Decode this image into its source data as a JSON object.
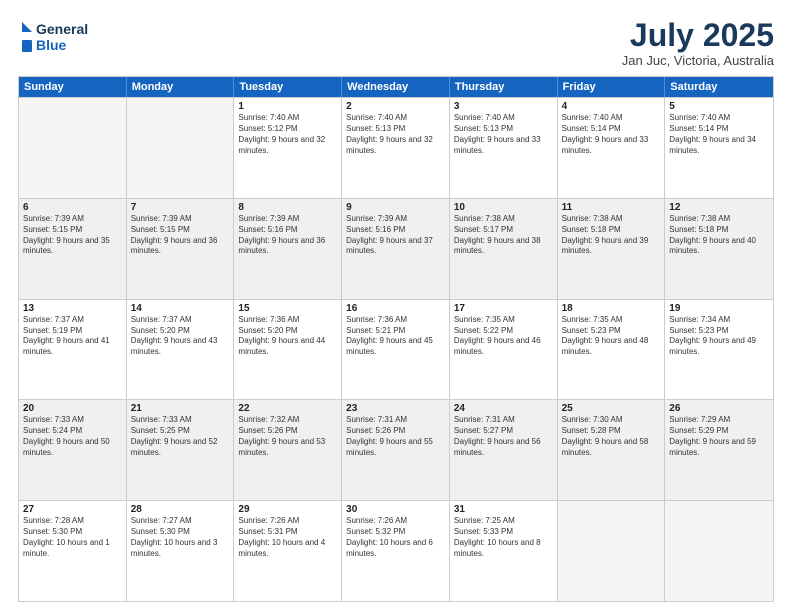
{
  "header": {
    "logo_line1": "General",
    "logo_line2": "Blue",
    "month": "July 2025",
    "location": "Jan Juc, Victoria, Australia"
  },
  "weekdays": [
    "Sunday",
    "Monday",
    "Tuesday",
    "Wednesday",
    "Thursday",
    "Friday",
    "Saturday"
  ],
  "rows": [
    [
      {
        "day": "",
        "text": ""
      },
      {
        "day": "",
        "text": ""
      },
      {
        "day": "1",
        "text": "Sunrise: 7:40 AM\nSunset: 5:12 PM\nDaylight: 9 hours and 32 minutes."
      },
      {
        "day": "2",
        "text": "Sunrise: 7:40 AM\nSunset: 5:13 PM\nDaylight: 9 hours and 32 minutes."
      },
      {
        "day": "3",
        "text": "Sunrise: 7:40 AM\nSunset: 5:13 PM\nDaylight: 9 hours and 33 minutes."
      },
      {
        "day": "4",
        "text": "Sunrise: 7:40 AM\nSunset: 5:14 PM\nDaylight: 9 hours and 33 minutes."
      },
      {
        "day": "5",
        "text": "Sunrise: 7:40 AM\nSunset: 5:14 PM\nDaylight: 9 hours and 34 minutes."
      }
    ],
    [
      {
        "day": "6",
        "text": "Sunrise: 7:39 AM\nSunset: 5:15 PM\nDaylight: 9 hours and 35 minutes."
      },
      {
        "day": "7",
        "text": "Sunrise: 7:39 AM\nSunset: 5:15 PM\nDaylight: 9 hours and 36 minutes."
      },
      {
        "day": "8",
        "text": "Sunrise: 7:39 AM\nSunset: 5:16 PM\nDaylight: 9 hours and 36 minutes."
      },
      {
        "day": "9",
        "text": "Sunrise: 7:39 AM\nSunset: 5:16 PM\nDaylight: 9 hours and 37 minutes."
      },
      {
        "day": "10",
        "text": "Sunrise: 7:38 AM\nSunset: 5:17 PM\nDaylight: 9 hours and 38 minutes."
      },
      {
        "day": "11",
        "text": "Sunrise: 7:38 AM\nSunset: 5:18 PM\nDaylight: 9 hours and 39 minutes."
      },
      {
        "day": "12",
        "text": "Sunrise: 7:38 AM\nSunset: 5:18 PM\nDaylight: 9 hours and 40 minutes."
      }
    ],
    [
      {
        "day": "13",
        "text": "Sunrise: 7:37 AM\nSunset: 5:19 PM\nDaylight: 9 hours and 41 minutes."
      },
      {
        "day": "14",
        "text": "Sunrise: 7:37 AM\nSunset: 5:20 PM\nDaylight: 9 hours and 43 minutes."
      },
      {
        "day": "15",
        "text": "Sunrise: 7:36 AM\nSunset: 5:20 PM\nDaylight: 9 hours and 44 minutes."
      },
      {
        "day": "16",
        "text": "Sunrise: 7:36 AM\nSunset: 5:21 PM\nDaylight: 9 hours and 45 minutes."
      },
      {
        "day": "17",
        "text": "Sunrise: 7:35 AM\nSunset: 5:22 PM\nDaylight: 9 hours and 46 minutes."
      },
      {
        "day": "18",
        "text": "Sunrise: 7:35 AM\nSunset: 5:23 PM\nDaylight: 9 hours and 48 minutes."
      },
      {
        "day": "19",
        "text": "Sunrise: 7:34 AM\nSunset: 5:23 PM\nDaylight: 9 hours and 49 minutes."
      }
    ],
    [
      {
        "day": "20",
        "text": "Sunrise: 7:33 AM\nSunset: 5:24 PM\nDaylight: 9 hours and 50 minutes."
      },
      {
        "day": "21",
        "text": "Sunrise: 7:33 AM\nSunset: 5:25 PM\nDaylight: 9 hours and 52 minutes."
      },
      {
        "day": "22",
        "text": "Sunrise: 7:32 AM\nSunset: 5:26 PM\nDaylight: 9 hours and 53 minutes."
      },
      {
        "day": "23",
        "text": "Sunrise: 7:31 AM\nSunset: 5:26 PM\nDaylight: 9 hours and 55 minutes."
      },
      {
        "day": "24",
        "text": "Sunrise: 7:31 AM\nSunset: 5:27 PM\nDaylight: 9 hours and 56 minutes."
      },
      {
        "day": "25",
        "text": "Sunrise: 7:30 AM\nSunset: 5:28 PM\nDaylight: 9 hours and 58 minutes."
      },
      {
        "day": "26",
        "text": "Sunrise: 7:29 AM\nSunset: 5:29 PM\nDaylight: 9 hours and 59 minutes."
      }
    ],
    [
      {
        "day": "27",
        "text": "Sunrise: 7:28 AM\nSunset: 5:30 PM\nDaylight: 10 hours and 1 minute."
      },
      {
        "day": "28",
        "text": "Sunrise: 7:27 AM\nSunset: 5:30 PM\nDaylight: 10 hours and 3 minutes."
      },
      {
        "day": "29",
        "text": "Sunrise: 7:26 AM\nSunset: 5:31 PM\nDaylight: 10 hours and 4 minutes."
      },
      {
        "day": "30",
        "text": "Sunrise: 7:26 AM\nSunset: 5:32 PM\nDaylight: 10 hours and 6 minutes."
      },
      {
        "day": "31",
        "text": "Sunrise: 7:25 AM\nSunset: 5:33 PM\nDaylight: 10 hours and 8 minutes."
      },
      {
        "day": "",
        "text": ""
      },
      {
        "day": "",
        "text": ""
      }
    ]
  ]
}
